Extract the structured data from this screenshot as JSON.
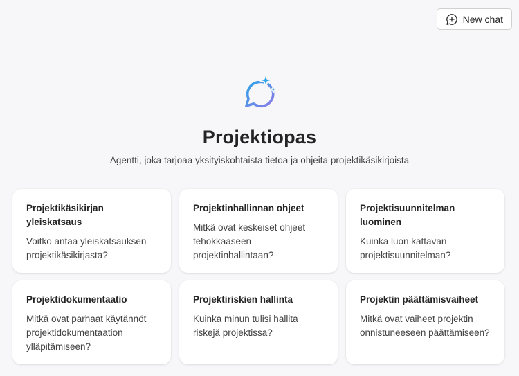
{
  "header": {
    "new_chat_label": "New chat",
    "new_chat_icon": "chat-add-icon"
  },
  "hero": {
    "logo_icon": "chat-sparkle-icon",
    "title": "Projektiopas",
    "subtitle": "Agentti, joka tarjoaa yksityiskohtaista tietoa ja ohjeita projektikäsikirjoista"
  },
  "suggestions": [
    {
      "title": "Projektikäsikirjan yleiskatsaus",
      "text": "Voitko antaa yleiskatsauksen projektikäsikirjasta?"
    },
    {
      "title": "Projektinhallinnan ohjeet",
      "text": "Mitkä ovat keskeiset ohjeet tehokkaaseen projektinhallintaan?"
    },
    {
      "title": "Projektisuunnitelman luominen",
      "text": "Kuinka luon kattavan projektisuunnitelman?"
    },
    {
      "title": "Projektidokumentaatio",
      "text": "Mitkä ovat parhaat käytännöt projektidokumentaation ylläpitämiseen?"
    },
    {
      "title": "Projektiriskien hallinta",
      "text": "Kuinka minun tulisi hallita riskejä projektissa?"
    },
    {
      "title": "Projektin päättämisvaiheet",
      "text": "Mitkä ovat vaiheet projektin onnistuneeseen päättämiseen?"
    }
  ],
  "colors": {
    "background": "#f7f7f9",
    "card": "#ffffff",
    "logo_gradient_start": "#2fa4e7",
    "logo_gradient_end": "#8a7be8"
  }
}
